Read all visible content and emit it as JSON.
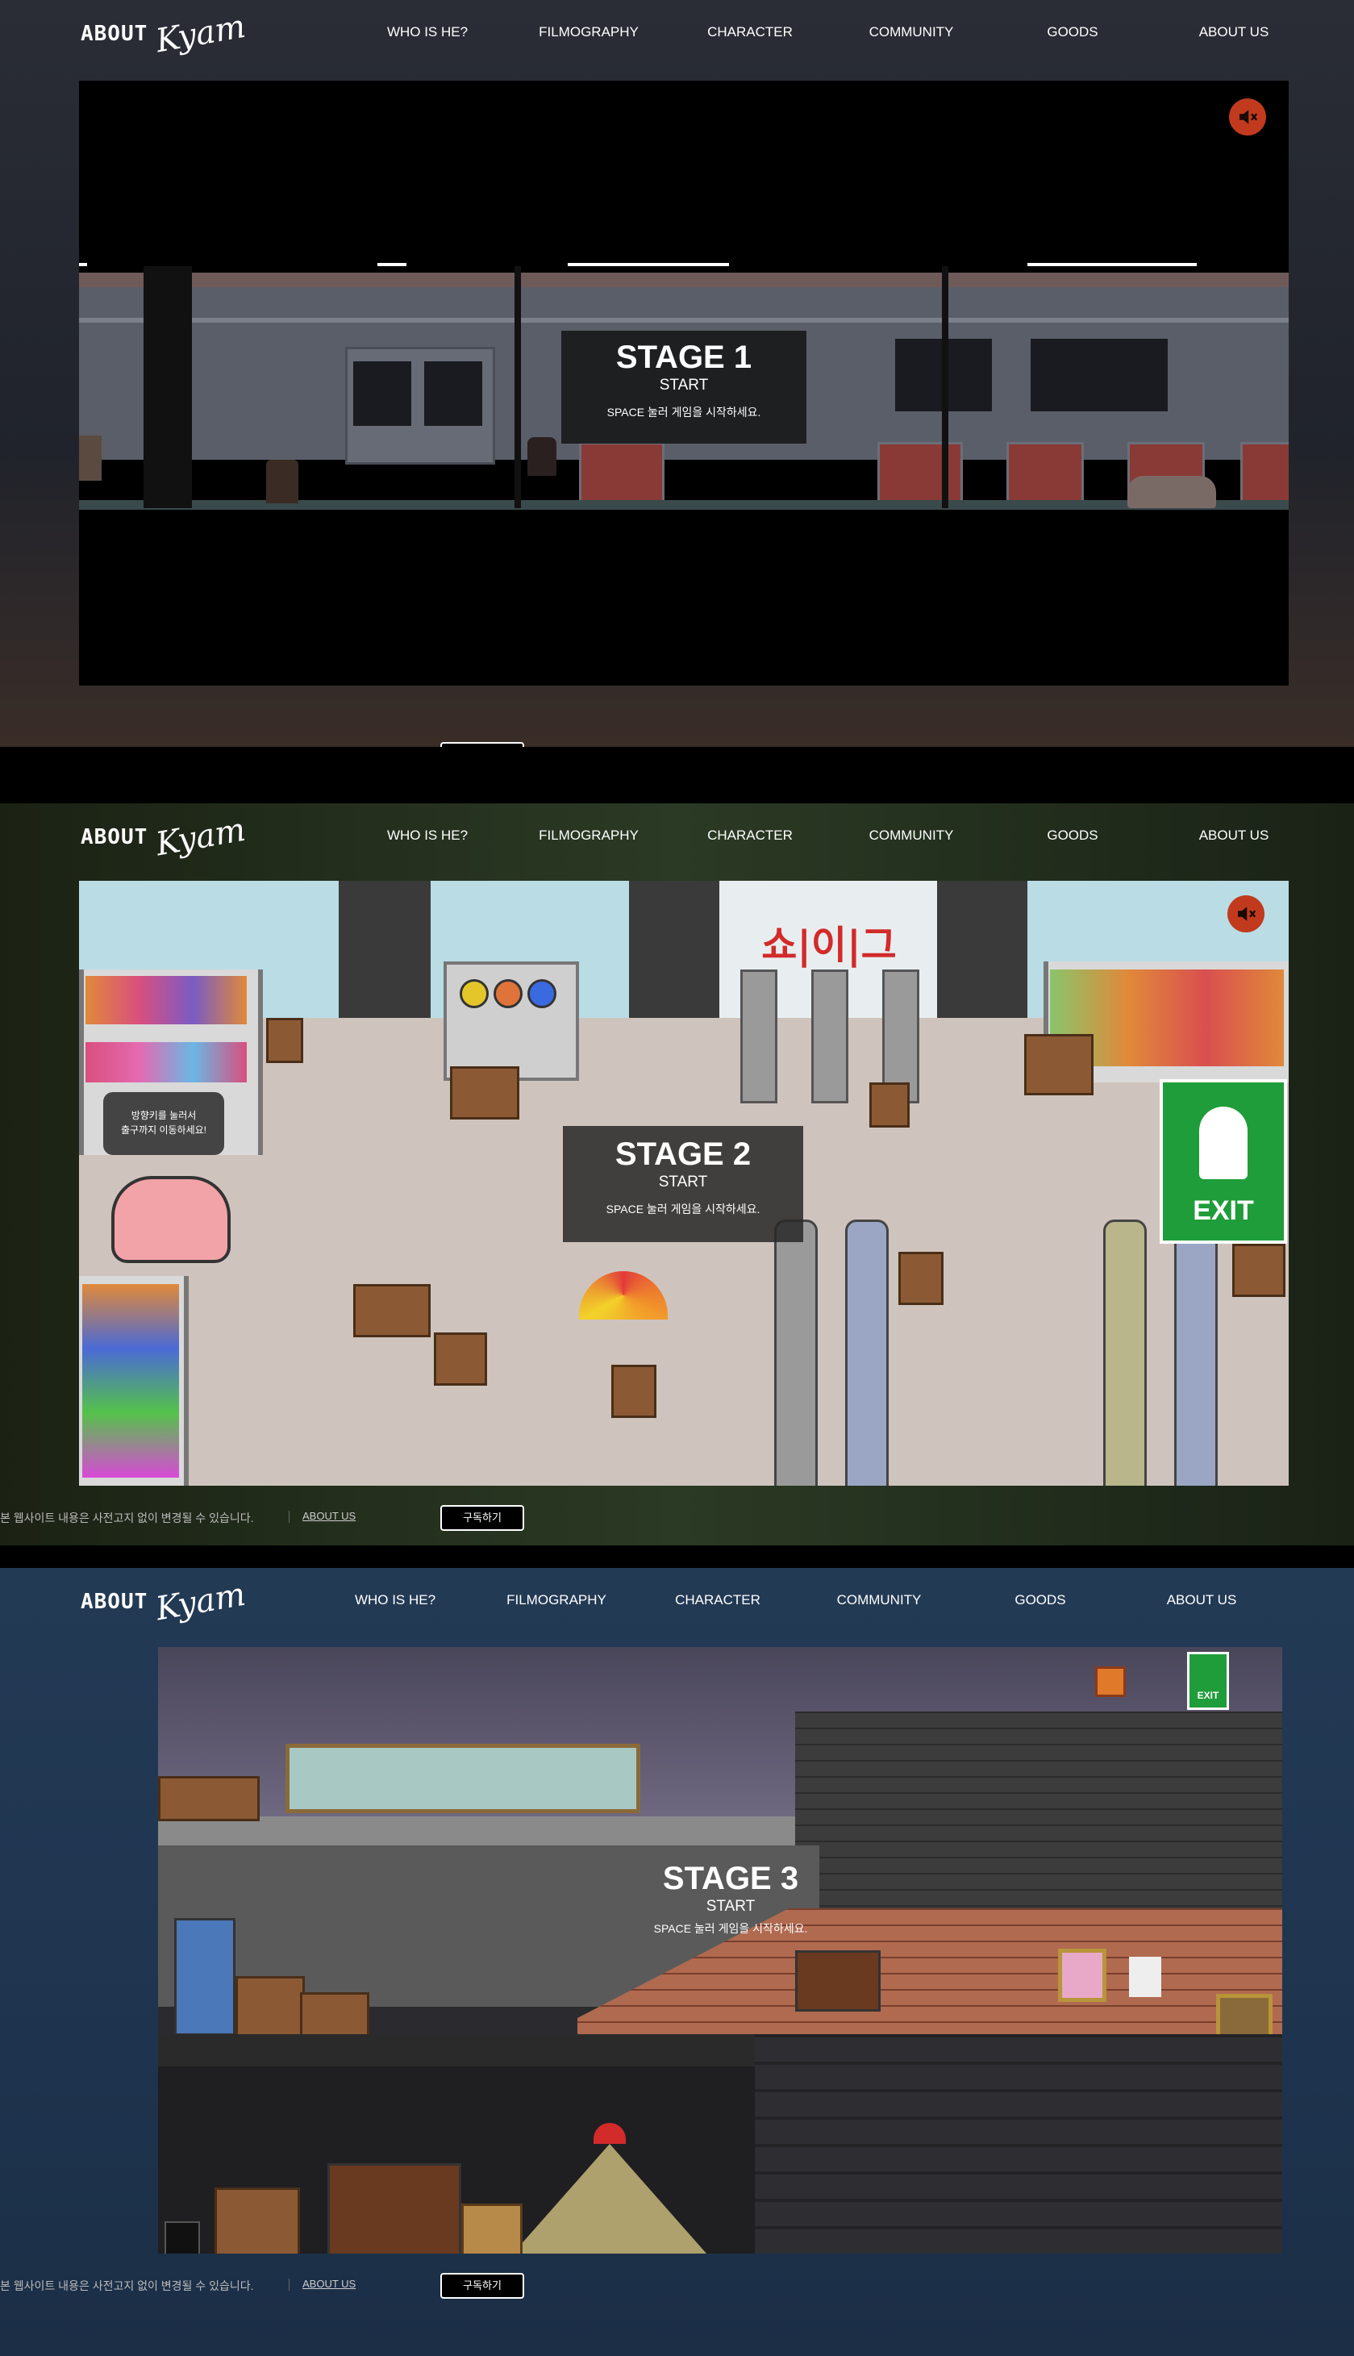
{
  "brand": {
    "logo_text": "ABOUT",
    "signature": "Kyam"
  },
  "nav": {
    "items": [
      {
        "label": "WHO IS HE?"
      },
      {
        "label": "FILMOGRAPHY"
      },
      {
        "label": "CHARACTER"
      },
      {
        "label": "COMMUNITY"
      },
      {
        "label": "GOODS"
      },
      {
        "label": "ABOUT US"
      }
    ]
  },
  "stages": [
    {
      "title": "STAGE 1",
      "start": "START",
      "hint": "SPACE 눌러 게임을 시작하세요."
    },
    {
      "title": "STAGE 2",
      "start": "START",
      "hint": "SPACE 눌러 게임을 시작하세요.",
      "bubble": "방향키를 눌러서\n출구까지 이동하세요!",
      "store_sign": "쇼|이|그",
      "exit_sign": "EXIT"
    },
    {
      "title": "STAGE 3",
      "start": "START",
      "hint": "SPACE 눌러 게임을 시작하세요.",
      "exit_sign": "EXIT"
    }
  ],
  "footer": {
    "notice": "본 웹사이트 내용은 사전고지 없이 변경될 수 있습니다.",
    "about_link": "ABOUT US",
    "subscribe_label": "구독하기"
  },
  "colors": {
    "sound_button": "#c23a1e",
    "brick": "#b06a4f",
    "exit_green": "#1f9d3a"
  },
  "icons": {
    "sound": "speaker-muted-icon"
  }
}
